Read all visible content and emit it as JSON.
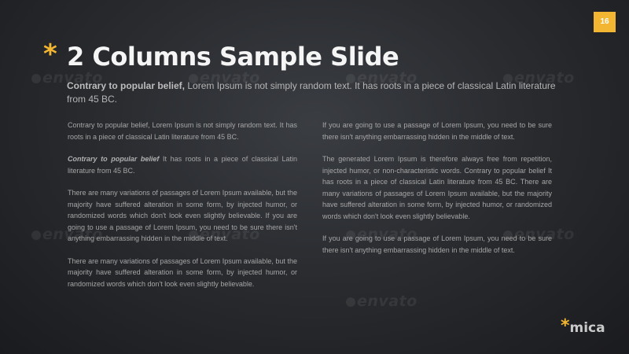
{
  "slide": {
    "page_number": "16",
    "title_asterisk": "*",
    "title": "2 Columns Sample Slide",
    "subtitle_bold": "Contrary to popular belief,",
    "subtitle_rest": " Lorem Ipsum is not simply random text. It has roots in a piece of classical Latin literature from 45 BC."
  },
  "left_column": {
    "p1": "Contrary to popular belief, Lorem Ipsum is not simply random text. It has roots in a piece of classical Latin literature from 45 BC.",
    "p2_emphasis": "Contrary to popular belief",
    "p2_rest": " It has roots in a piece of classical Latin literature from 45 BC.",
    "p3": "There are many variations of passages of Lorem Ipsum available, but the majority have suffered alteration in some form, by injected humor, or randomized words which don't look even slightly believable. If you are going to use a passage of Lorem Ipsum, you need to be sure there isn't anything embarrassing hidden in the middle of text.",
    "p4": "There are many variations of passages of Lorem Ipsum available, but the majority have suffered alteration in some form, by injected humor, or randomized words which don't look even slightly believable."
  },
  "right_column": {
    "p1": "If you are going to use a passage of Lorem Ipsum, you need to be sure there isn't anything embarrassing hidden in the middle of text.",
    "p2": "The generated Lorem Ipsum is therefore always free from repetition, injected humor, or non-characteristic words. Contrary to popular belief It has roots in a piece of classical Latin literature from 45 BC. There are many variations of passages of Lorem Ipsum available, but the majority have suffered alteration in some form, by injected humor, or randomized words which don't look even slightly believable.",
    "p3": "If you are going to use a passage of Lorem Ipsum, you need to be sure there isn't anything embarrassing hidden in the middle of text."
  },
  "watermark": {
    "text": "envato"
  },
  "logo": {
    "asterisk": "*",
    "text": "mica"
  },
  "colors": {
    "accent": "#f2b632",
    "background": "#2a2c30",
    "title": "#f5f5f5",
    "body_text": "#a6a6a6"
  }
}
